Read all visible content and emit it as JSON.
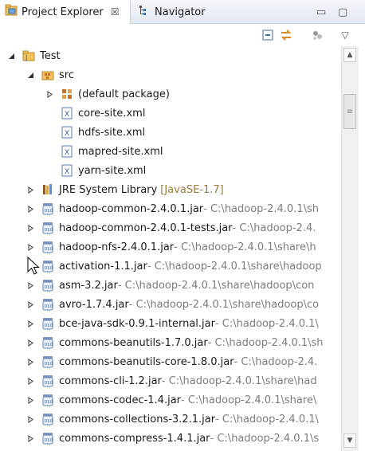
{
  "tabs": {
    "project_explorer": {
      "label": "Project Explorer",
      "close": "☒",
      "icon": "project-explorer-icon"
    },
    "navigator": {
      "label": "Navigator",
      "icon": "navigator-icon"
    }
  },
  "window_buttons": {
    "minimize": "▭",
    "maximize": "▢"
  },
  "toolbar": {
    "collapse_all": "collapse-all-icon",
    "link_with_editor": "link-with-editor-icon",
    "focus": "focus-icon",
    "view_menu": "▽"
  },
  "tree": {
    "project": {
      "label": "Test"
    },
    "src": {
      "label": "src"
    },
    "default_package": {
      "label": "(default package)"
    },
    "files": [
      "core-site.xml",
      "hdfs-site.xml",
      "mapred-site.xml",
      "yarn-site.xml"
    ],
    "jre": {
      "label": "JRE System Library",
      "decoration": "[JavaSE-1.7]"
    },
    "jars": [
      {
        "label": "hadoop-common-2.4.0.1.jar",
        "path": " - C:\\hadoop-2.4.0.1\\sh"
      },
      {
        "label": "hadoop-common-2.4.0.1-tests.jar",
        "path": " - C:\\hadoop-2.4."
      },
      {
        "label": "hadoop-nfs-2.4.0.1.jar",
        "path": " - C:\\hadoop-2.4.0.1\\share\\h"
      },
      {
        "label": "activation-1.1.jar",
        "path": " - C:\\hadoop-2.4.0.1\\share\\hadoop"
      },
      {
        "label": "asm-3.2.jar",
        "path": " - C:\\hadoop-2.4.0.1\\share\\hadoop\\con"
      },
      {
        "label": "avro-1.7.4.jar",
        "path": " - C:\\hadoop-2.4.0.1\\share\\hadoop\\co"
      },
      {
        "label": "bce-java-sdk-0.9.1-internal.jar",
        "path": " - C:\\hadoop-2.4.0.1\\"
      },
      {
        "label": "commons-beanutils-1.7.0.jar",
        "path": " - C:\\hadoop-2.4.0.1\\sh"
      },
      {
        "label": "commons-beanutils-core-1.8.0.jar",
        "path": " - C:\\hadoop-2.4."
      },
      {
        "label": "commons-cli-1.2.jar",
        "path": " - C:\\hadoop-2.4.0.1\\share\\had"
      },
      {
        "label": "commons-codec-1.4.jar",
        "path": " - C:\\hadoop-2.4.0.1\\share\\"
      },
      {
        "label": "commons-collections-3.2.1.jar",
        "path": " - C:\\hadoop-2.4.0.1\\"
      },
      {
        "label": "commons-compress-1.4.1.jar",
        "path": " - C:\\hadoop-2.4.0.1\\s"
      }
    ],
    "jar_icon_text": "010"
  },
  "scrollbar": {
    "up": "▲",
    "down": "▼",
    "grip": "≡"
  }
}
